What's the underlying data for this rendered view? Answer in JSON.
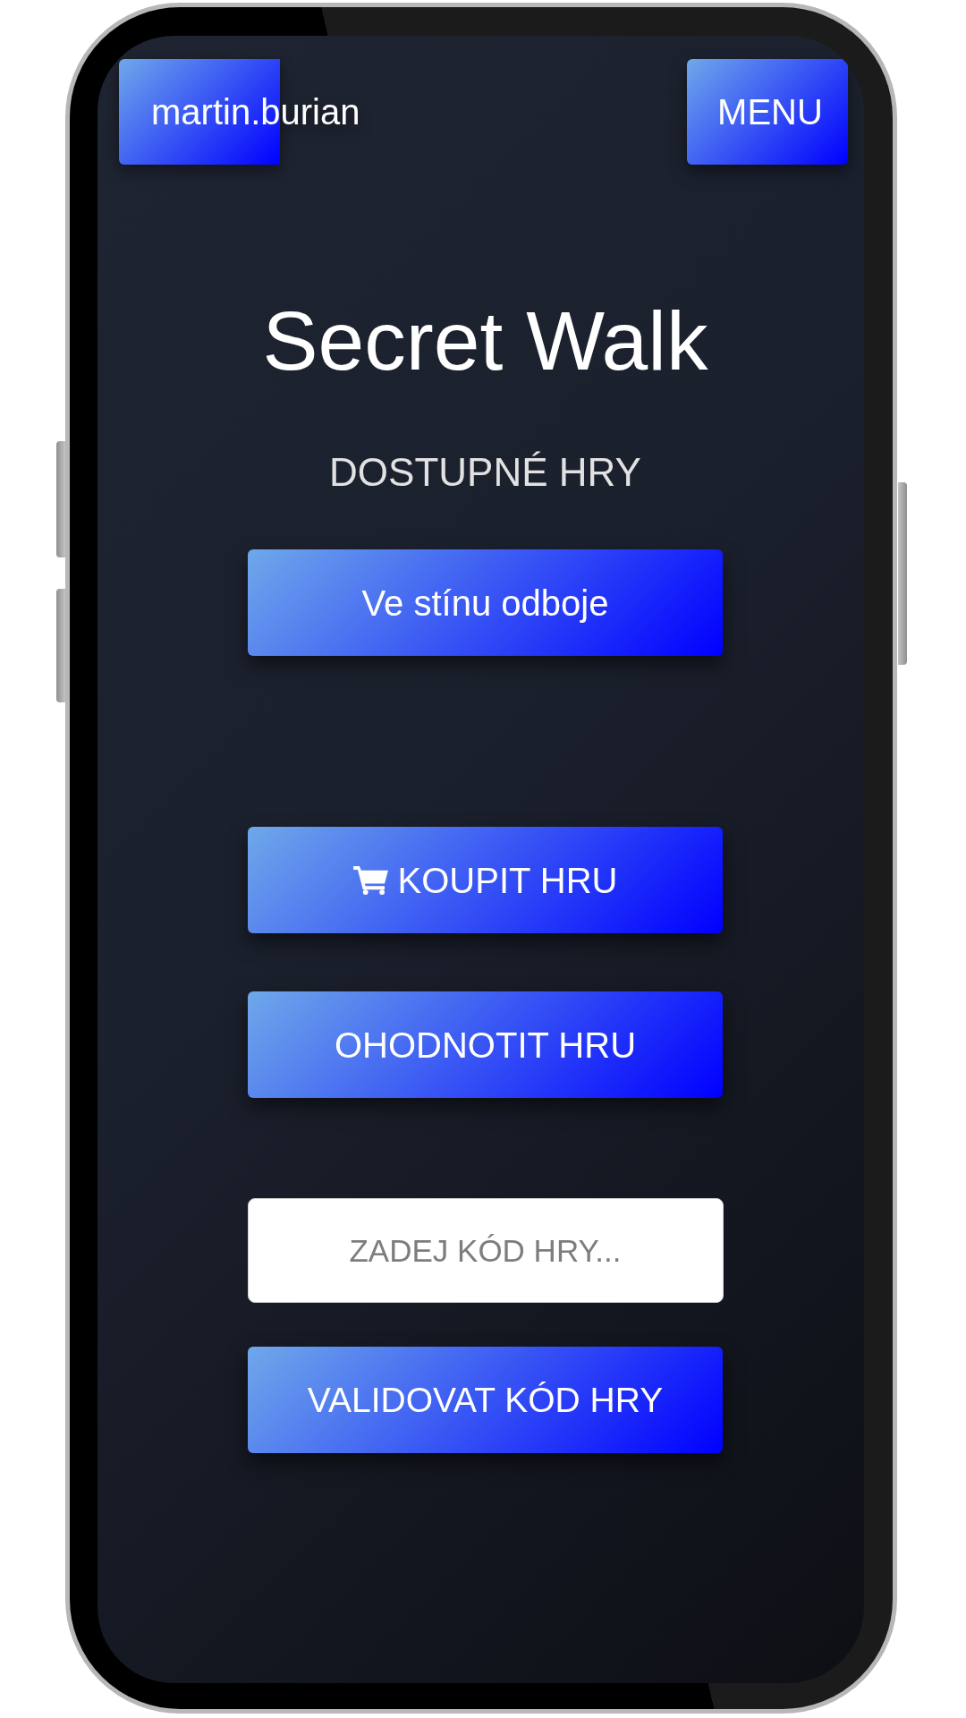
{
  "header": {
    "user_button": "martin.burian",
    "menu_button": "MENU"
  },
  "title": "Secret Walk",
  "section_heading": "DOSTUPNÉ HRY",
  "games": [
    {
      "title": "Ve stínu odboje"
    }
  ],
  "actions": [
    {
      "kind": "purchase",
      "label": "KOUPIT HRU"
    },
    {
      "kind": "rating",
      "label": "OHODNOTIT HRU"
    }
  ],
  "code_input": {
    "placeholder": "ZADEJ KÓD HRY..."
  },
  "validate_button": "VALIDOVAT KÓD HRY"
}
